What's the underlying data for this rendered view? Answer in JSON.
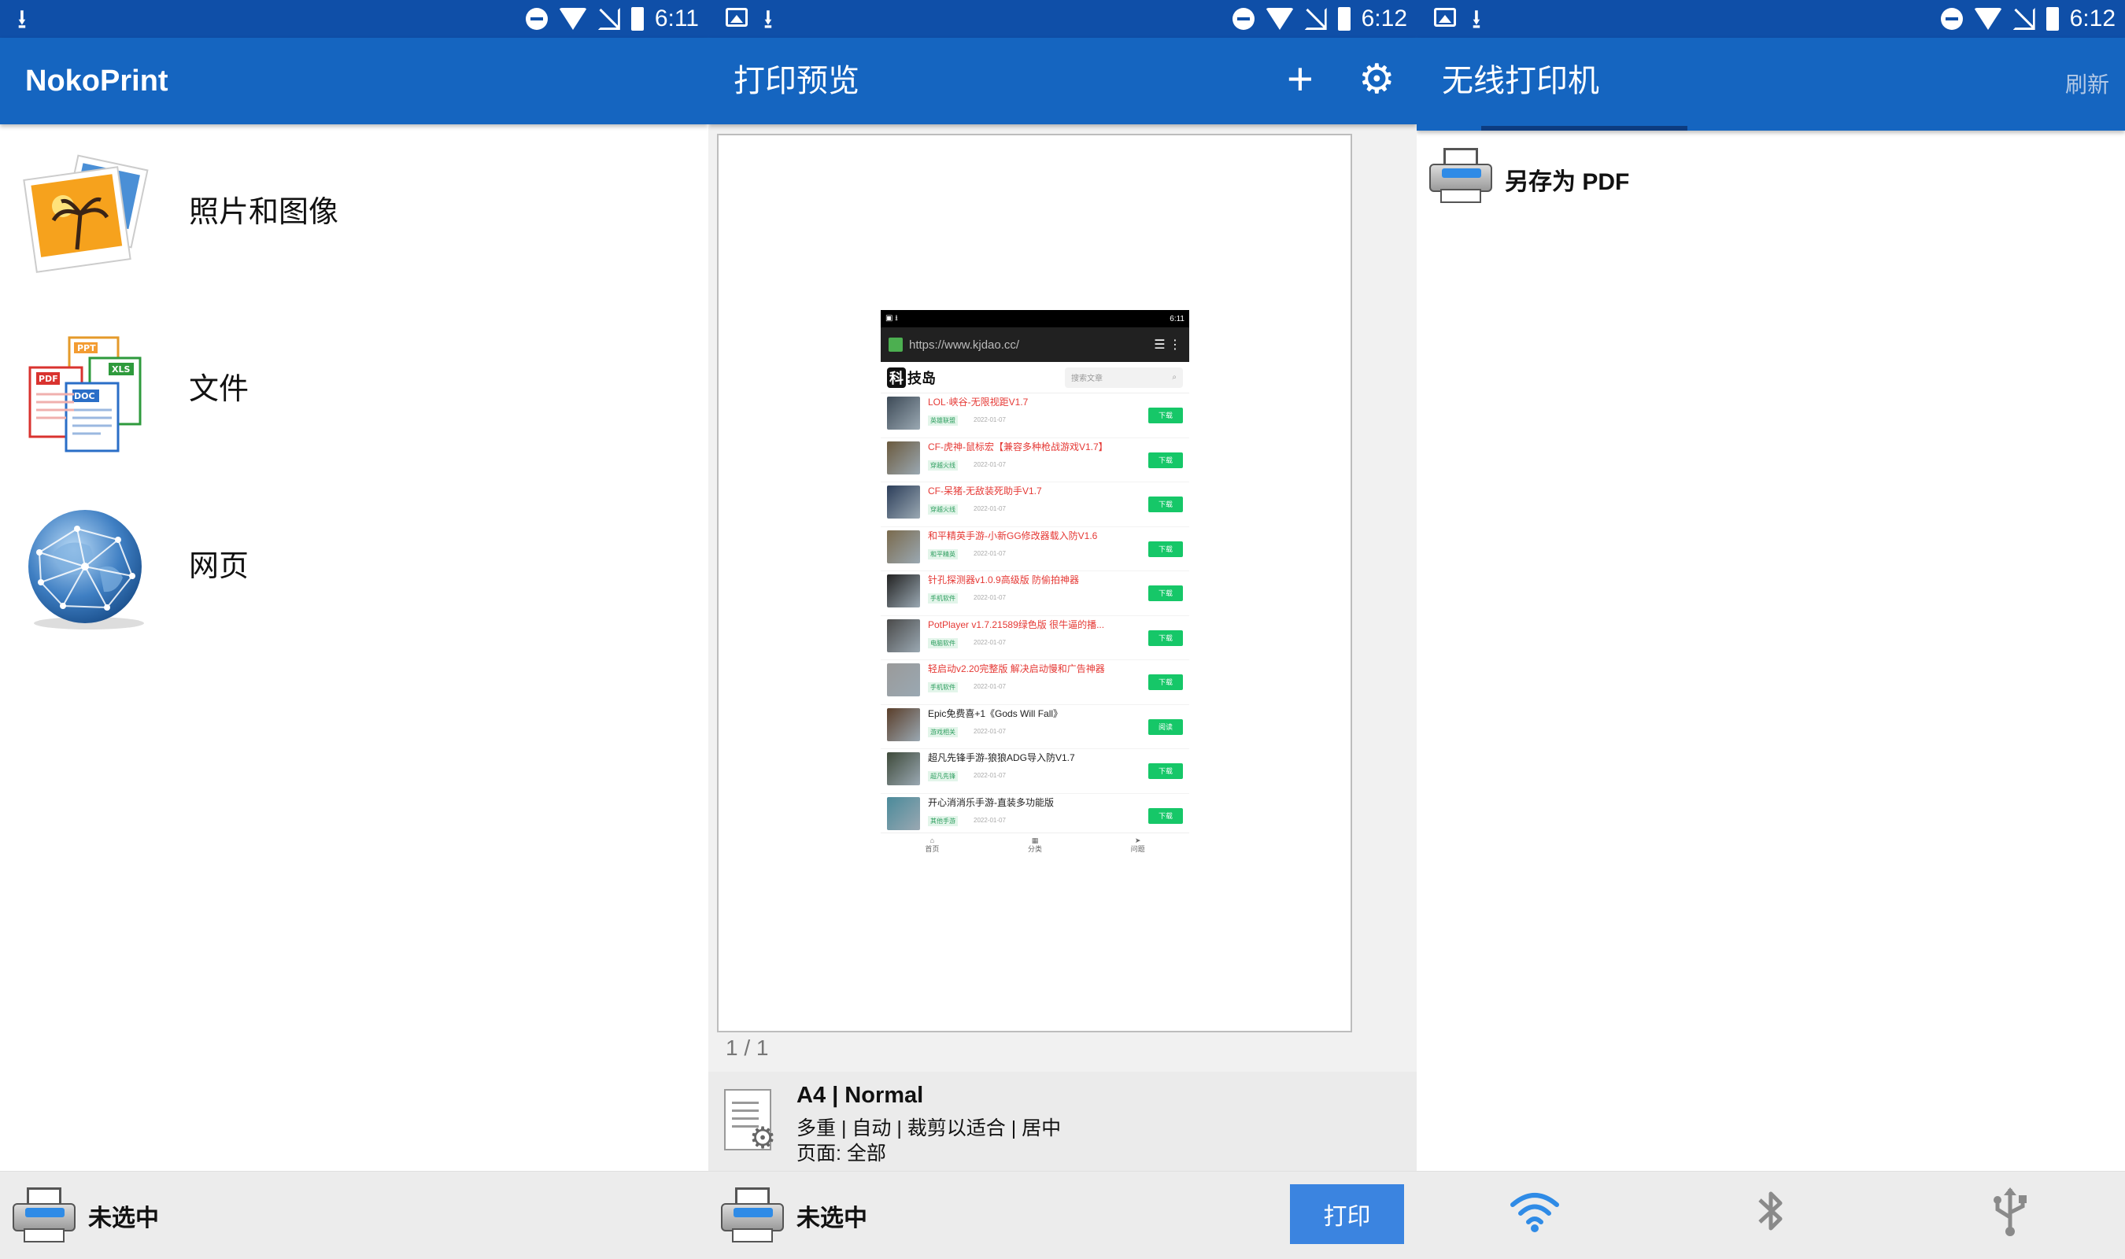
{
  "panels": {
    "home": {
      "status": {
        "time": "6:11"
      },
      "appbar": {
        "title": "NokoPrint"
      },
      "menu": [
        {
          "label": "照片和图像",
          "icon": "photos-icon"
        },
        {
          "label": "文件",
          "icon": "files-icon"
        },
        {
          "label": "网页",
          "icon": "globe-icon"
        }
      ],
      "bottom": {
        "printer_label": "未选中"
      }
    },
    "preview": {
      "status": {
        "time": "6:12"
      },
      "appbar": {
        "title": "打印预览",
        "add_icon": "+",
        "settings_icon": "⚙"
      },
      "pager": "1 / 1",
      "settings": {
        "line1": "A4 | Normal",
        "line2": "多重 | 自动 | 裁剪以适合 | 居中",
        "line3": "页面: 全部"
      },
      "bottom": {
        "printer_label": "未选中",
        "print_button": "打印"
      }
    },
    "printers": {
      "status": {
        "time": "6:12"
      },
      "appbar": {
        "title": "无线打印机",
        "refresh": "刷新"
      },
      "items": [
        {
          "label": "另存为 PDF"
        }
      ],
      "bottom": {
        "wifi_icon": "wifi-icon",
        "bluetooth_icon": "bluetooth-icon",
        "usb_icon": "usb-icon"
      }
    }
  },
  "mini_screen": {
    "time": "6:11",
    "url": "https://www.kjdao.cc/",
    "logo_k": "科",
    "logo_rest": "技岛",
    "search_placeholder": "搜索文章",
    "rows": [
      {
        "title": "LOL·峡谷-无限视距V1.7",
        "tag": "英雄联盟",
        "date": "2022-01-07",
        "action": "下载",
        "color": "red"
      },
      {
        "title": "CF-虎神-鼠标宏【兼容多种枪战游戏V1.7】",
        "tag": "穿越火线",
        "date": "2022-01-07",
        "action": "下载",
        "color": "red"
      },
      {
        "title": "CF-呆猪-无敌装死助手V1.7",
        "tag": "穿越火线",
        "date": "2022-01-07",
        "action": "下载",
        "color": "red"
      },
      {
        "title": "和平精英手游-小新GG修改器载入防V1.6",
        "tag": "和平精英",
        "date": "2022-01-07",
        "action": "下载",
        "color": "red"
      },
      {
        "title": "针孔探测器v1.0.9高级版 防偷拍神器",
        "tag": "手机软件",
        "date": "2022-01-07",
        "action": "下载",
        "color": "red"
      },
      {
        "title": "PotPlayer v1.7.21589绿色版 很牛逼的播...",
        "tag": "电脑软件",
        "date": "2022-01-07",
        "action": "下载",
        "color": "red"
      },
      {
        "title": "轻启动v2.20完整版 解决启动慢和广告神器",
        "tag": "手机软件",
        "date": "2022-01-07",
        "action": "下载",
        "color": "red"
      },
      {
        "title": "Epic免费喜+1《Gods Will Fall》",
        "tag": "游戏相关",
        "date": "2022-01-07",
        "action": "阅读",
        "color": "dark"
      },
      {
        "title": "超凡先锋手游-狼狼ADG导入防V1.7",
        "tag": "超凡先锋",
        "date": "2022-01-07",
        "action": "下载",
        "color": "dark"
      },
      {
        "title": "开心消消乐手游-直装多功能版",
        "tag": "其他手游",
        "date": "2022-01-07",
        "action": "下载",
        "color": "dark"
      }
    ],
    "nav": [
      "首页",
      "分类",
      "问题"
    ]
  }
}
